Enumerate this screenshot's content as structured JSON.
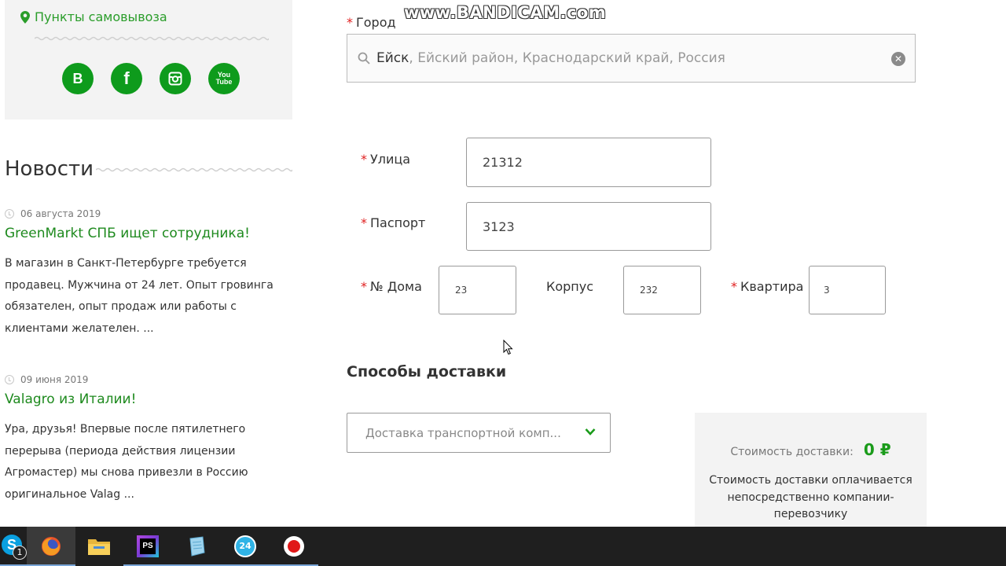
{
  "left": {
    "pickup_label": "Пункты самовывоза",
    "social": [
      {
        "icon": "vk-icon",
        "glyph": "B"
      },
      {
        "icon": "facebook-icon",
        "glyph": "f"
      },
      {
        "icon": "instagram-icon",
        "glyph": ""
      },
      {
        "icon": "youtube-icon",
        "glyph": "You Tube"
      }
    ],
    "news_heading": "Новости",
    "news": [
      {
        "date": "06 августа 2019",
        "title": "GreenMarkt СПБ ищет сотрудника!",
        "text": "В магазин в Санкт-Петербурге требуется продавец. Мужчина от 24 лет. Опыт гровинга обязателен, опыт продаж или работы с клиентами желателен. ..."
      },
      {
        "date": "09 июня 2019",
        "title": "Valagro из Италии!",
        "text": "Ура, друзья! Впервые после пятилетнего перерыва (периода действия лицензии Агромастер) мы снова привезли в Россию оригинальное Valag ..."
      }
    ]
  },
  "form": {
    "city_label": "Город",
    "city_value": "Ейск",
    "city_suffix": ", Ейский район, Краснодарский край, Россия",
    "street_label": "Улица",
    "street_value": "21312",
    "passport_label": "Паспорт",
    "passport_value": "3123",
    "house_label": "№ Дома",
    "house_value": "23",
    "building_label": "Корпус",
    "building_value": "232",
    "apartment_label": "Квартира",
    "apartment_value": "3",
    "required_mark": "*"
  },
  "delivery": {
    "heading": "Способы доставки",
    "method_selected": "Доставка транспортной комп...",
    "cost_label": "Стоимость доставки:",
    "cost_value": "0 ₽",
    "cost_note": "Стоимость доставки оплачивается непосредственно компании-перевозчику"
  },
  "watermark": "www.BANDICAM.com",
  "taskbar": {
    "skype_badge": "1",
    "phpstorm_label": "PS",
    "app24_label": "24"
  },
  "colors": {
    "accent_green": "#0e9b1c",
    "link_green": "#1e8a1e",
    "required_red": "#e02020"
  }
}
